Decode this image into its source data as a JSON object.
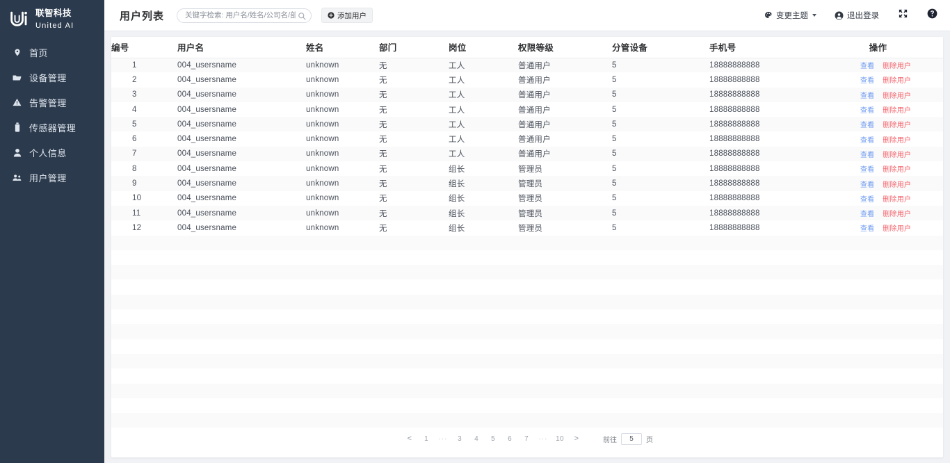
{
  "brand": {
    "name_cn": "联智科技",
    "name_en": "United AI",
    "logo_icon": "uni-logo-icon"
  },
  "sidebar": {
    "items": [
      {
        "label": "首页",
        "icon": "map-pin-icon"
      },
      {
        "label": "设备管理",
        "icon": "folder-icon"
      },
      {
        "label": "告警管理",
        "icon": "warning-triangle-icon"
      },
      {
        "label": "传感器管理",
        "icon": "sensor-icon"
      },
      {
        "label": "个人信息",
        "icon": "user-icon"
      },
      {
        "label": "用户管理",
        "icon": "users-icon"
      }
    ]
  },
  "header": {
    "title": "用户列表",
    "search": {
      "placeholder": "关键字检索: 用户名/姓名/公司名/部门",
      "value": "",
      "icon": "search-icon"
    },
    "add_button": {
      "label": "添加用户",
      "icon": "plus-circle-icon"
    },
    "theme_button": {
      "label": "变更主题",
      "icon": "palette-icon",
      "caret": "chevron-down-icon"
    },
    "logout_button": {
      "label": "退出登录",
      "icon": "account-circle-icon"
    },
    "fullscreen_button": {
      "icon": "fullscreen-icon"
    },
    "help_button": {
      "icon": "help-circle-icon"
    }
  },
  "table": {
    "columns": [
      "编号",
      "用户名",
      "姓名",
      "部门",
      "岗位",
      "权限等级",
      "分管设备",
      "手机号",
      "操作"
    ],
    "action_labels": {
      "view": "查看",
      "delete": "删除用户"
    },
    "rows": [
      {
        "id": "1",
        "username": "004_usersname",
        "name": "unknown",
        "dept": "无",
        "post": "工人",
        "level": "普通用户",
        "equip": "5",
        "phone": "18888888888"
      },
      {
        "id": "2",
        "username": "004_usersname",
        "name": "unknown",
        "dept": "无",
        "post": "工人",
        "level": "普通用户",
        "equip": "5",
        "phone": "18888888888"
      },
      {
        "id": "3",
        "username": "004_usersname",
        "name": "unknown",
        "dept": "无",
        "post": "工人",
        "level": "普通用户",
        "equip": "5",
        "phone": "18888888888"
      },
      {
        "id": "4",
        "username": "004_usersname",
        "name": "unknown",
        "dept": "无",
        "post": "工人",
        "level": "普通用户",
        "equip": "5",
        "phone": "18888888888"
      },
      {
        "id": "5",
        "username": "004_usersname",
        "name": "unknown",
        "dept": "无",
        "post": "工人",
        "level": "普通用户",
        "equip": "5",
        "phone": "18888888888"
      },
      {
        "id": "6",
        "username": "004_usersname",
        "name": "unknown",
        "dept": "无",
        "post": "工人",
        "level": "普通用户",
        "equip": "5",
        "phone": "18888888888"
      },
      {
        "id": "7",
        "username": "004_usersname",
        "name": "unknown",
        "dept": "无",
        "post": "工人",
        "level": "普通用户",
        "equip": "5",
        "phone": "18888888888"
      },
      {
        "id": "8",
        "username": "004_usersname",
        "name": "unknown",
        "dept": "无",
        "post": "组长",
        "level": "管理员",
        "equip": "5",
        "phone": "18888888888"
      },
      {
        "id": "9",
        "username": "004_usersname",
        "name": "unknown",
        "dept": "无",
        "post": "组长",
        "level": "管理员",
        "equip": "5",
        "phone": "18888888888"
      },
      {
        "id": "10",
        "username": "004_usersname",
        "name": "unknown",
        "dept": "无",
        "post": "组长",
        "level": "管理员",
        "equip": "5",
        "phone": "18888888888"
      },
      {
        "id": "11",
        "username": "004_usersname",
        "name": "unknown",
        "dept": "无",
        "post": "组长",
        "level": "管理员",
        "equip": "5",
        "phone": "18888888888"
      },
      {
        "id": "12",
        "username": "004_usersname",
        "name": "unknown",
        "dept": "无",
        "post": "组长",
        "level": "管理员",
        "equip": "5",
        "phone": "18888888888"
      }
    ],
    "empty_filler_rows": 13
  },
  "pagination": {
    "prev": "<",
    "next": ">",
    "pages": [
      "1",
      "···",
      "3",
      "4",
      "5",
      "6",
      "7",
      "···",
      "10"
    ],
    "jump_label": "前往",
    "jump_value": "5",
    "jump_suffix": "页"
  },
  "colors": {
    "sidebar_bg": "#2b3a4d",
    "page_bg": "#f0f2f5",
    "panel_bg": "#ffffff",
    "row_stripe": "#fafafa",
    "link_view": "#6f9bf0",
    "link_delete": "#f4636c"
  }
}
